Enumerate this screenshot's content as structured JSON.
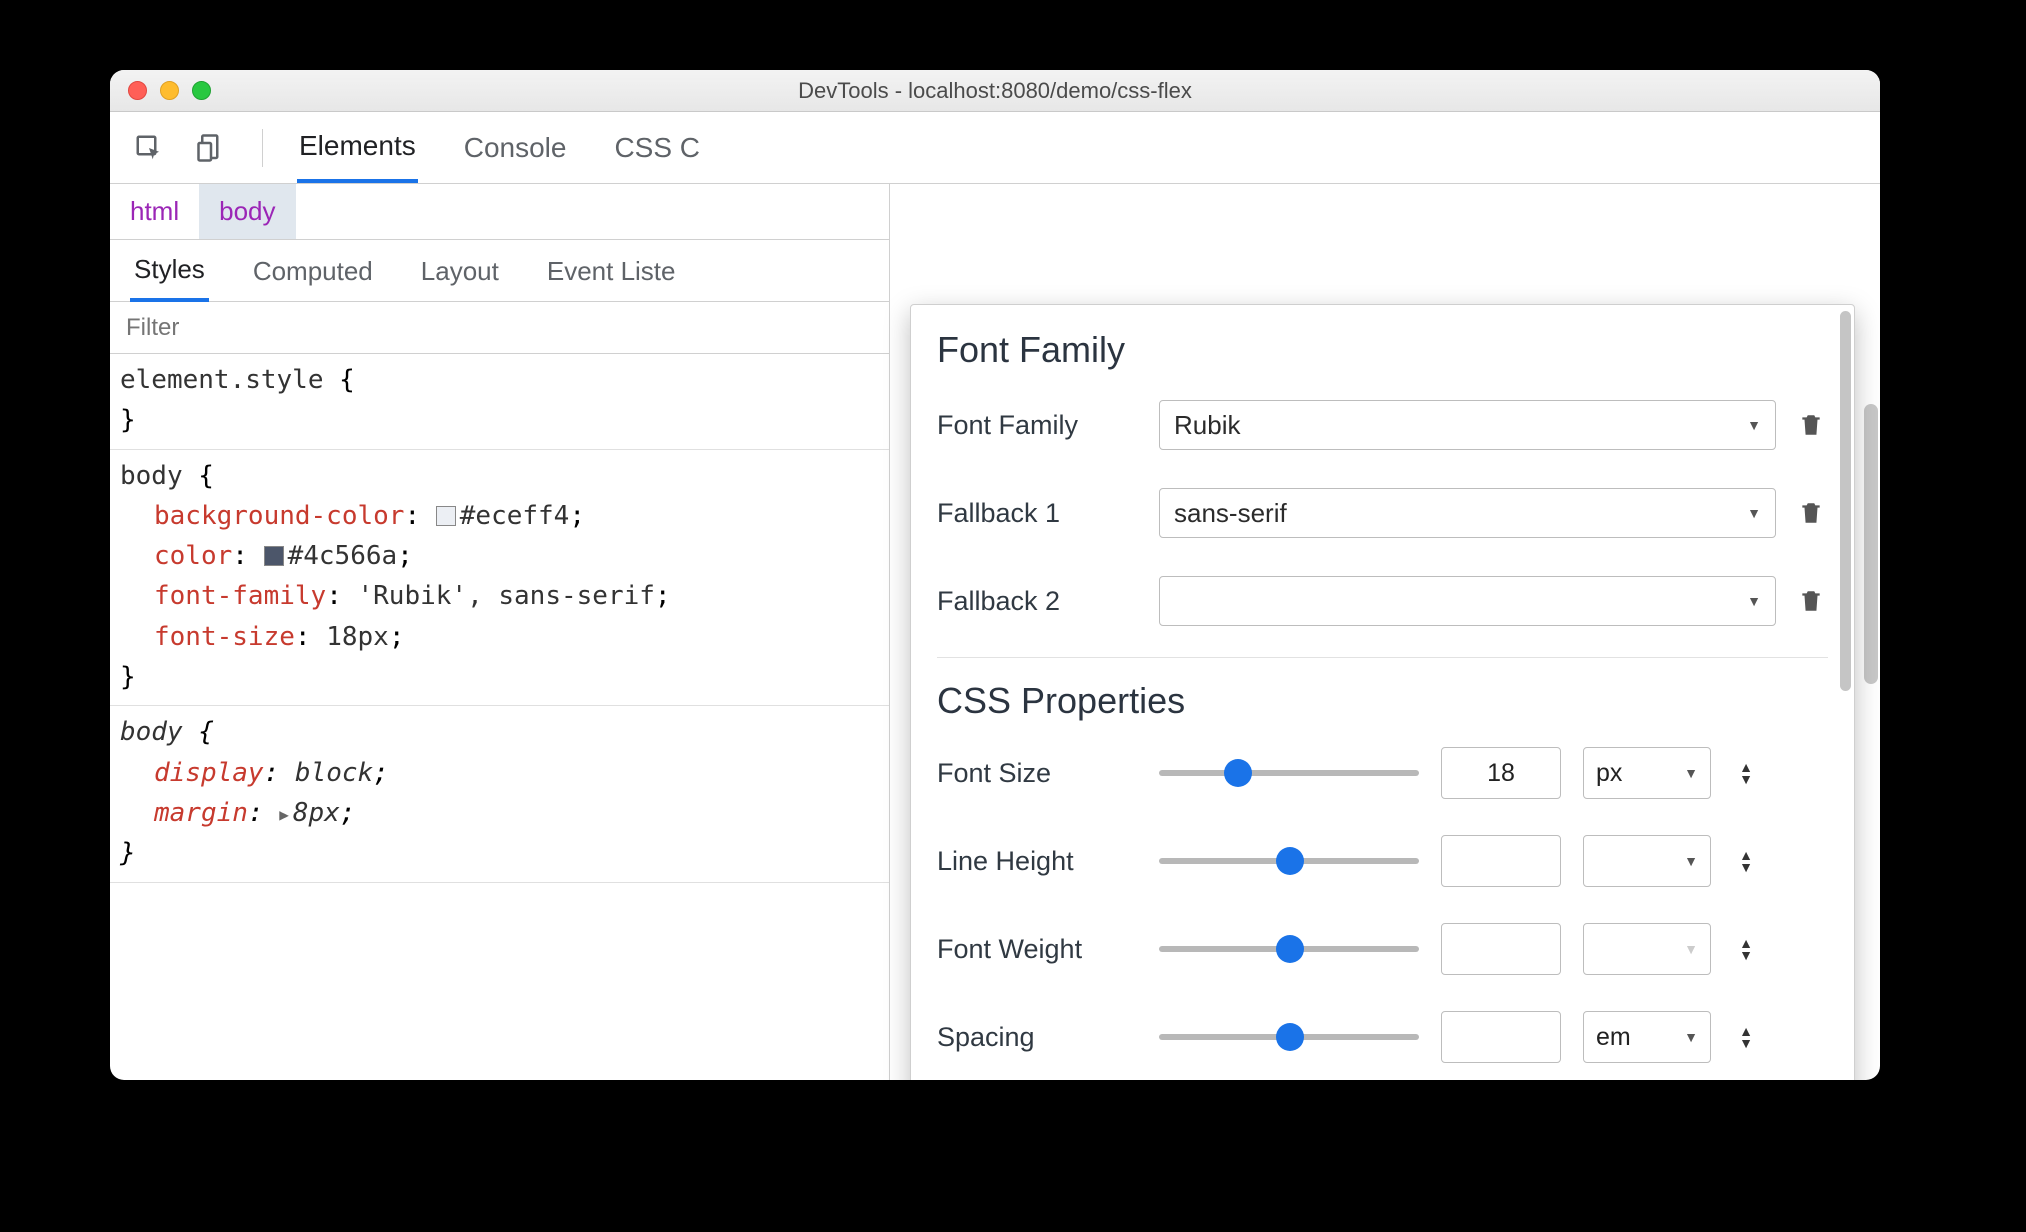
{
  "window": {
    "title": "DevTools - localhost:8080/demo/css-flex"
  },
  "tabs": {
    "items": [
      "Elements",
      "Console",
      "CSS Overview"
    ],
    "active": 0,
    "visible_third_truncated": "CSS C"
  },
  "breadcrumb": {
    "items": [
      "html",
      "body"
    ],
    "selected": 1
  },
  "subtabs": {
    "items": [
      "Styles",
      "Computed",
      "Layout",
      "Event Listeners"
    ],
    "visible_last_truncated": "Event Liste",
    "active": 0
  },
  "filter": {
    "placeholder": "Filter"
  },
  "styles": {
    "rules": [
      {
        "selector": "element.style",
        "open": "{",
        "close": "}",
        "props": []
      },
      {
        "selector": "body",
        "open": "{",
        "close": "}",
        "props": [
          {
            "name": "background-color",
            "value": "#eceff4",
            "swatch": "#eceff4"
          },
          {
            "name": "color",
            "value": "#4c566a",
            "swatch": "#4c566a"
          },
          {
            "name": "font-family",
            "value": "'Rubik', sans-serif"
          },
          {
            "name": "font-size",
            "value": "18px"
          }
        ]
      },
      {
        "selector": "body",
        "italic": true,
        "open": "{",
        "close": "}",
        "props": [
          {
            "name": "display",
            "value": "block",
            "italic": true
          },
          {
            "name": "margin",
            "value": "8px",
            "italic": true,
            "expander": true
          }
        ]
      }
    ]
  },
  "popover": {
    "sections": {
      "font_family": {
        "title": "Font Family",
        "rows": [
          {
            "label": "Font Family",
            "value": "Rubik"
          },
          {
            "label": "Fallback 1",
            "value": "sans-serif"
          },
          {
            "label": "Fallback 2",
            "value": ""
          }
        ]
      },
      "css_properties": {
        "title": "CSS Properties",
        "rows": [
          {
            "label": "Font Size",
            "value": "18",
            "unit": "px",
            "slider": 0.25
          },
          {
            "label": "Line Height",
            "value": "",
            "unit": "",
            "slider": 0.45
          },
          {
            "label": "Font Weight",
            "value": "",
            "unit": "",
            "slider": 0.45,
            "unit_disabled": true
          },
          {
            "label": "Spacing",
            "value": "",
            "unit": "em",
            "slider": 0.45
          }
        ]
      }
    }
  }
}
